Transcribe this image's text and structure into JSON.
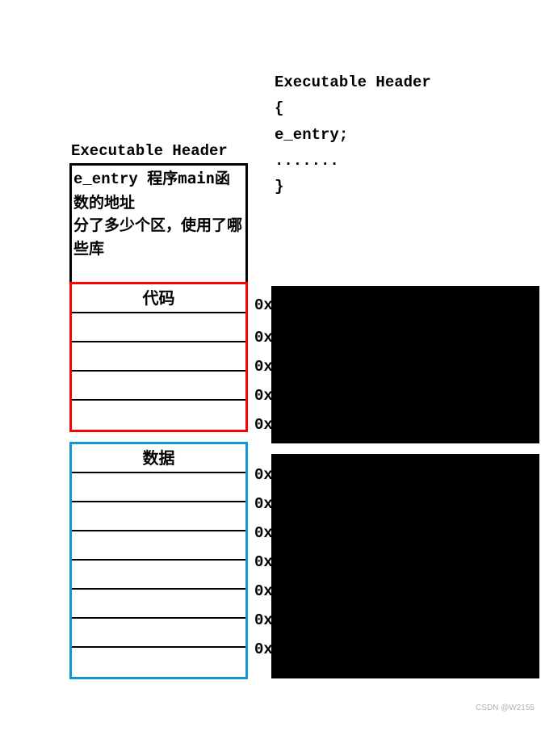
{
  "left": {
    "exec_title": "Executable Header",
    "header_box_line1_mono": "e_entry",
    "header_box_line1_cn": " 程序main函数的地址",
    "header_box_line2": "分了多少个区，使用了哪些库",
    "code_title": "代码",
    "data_title": "数据"
  },
  "right": {
    "line1": "Executable Header",
    "line2": "{",
    "line3": " e_entry;",
    "line4": " .......",
    "line5": "}"
  },
  "addrs_top": [
    "0x",
    "0x",
    "0x",
    "0x",
    "0x"
  ],
  "addrs_bottom": [
    "0x",
    "0x",
    "0x",
    "0x",
    "0x",
    "0x",
    "0x"
  ],
  "watermark": "CSDN @W2155"
}
